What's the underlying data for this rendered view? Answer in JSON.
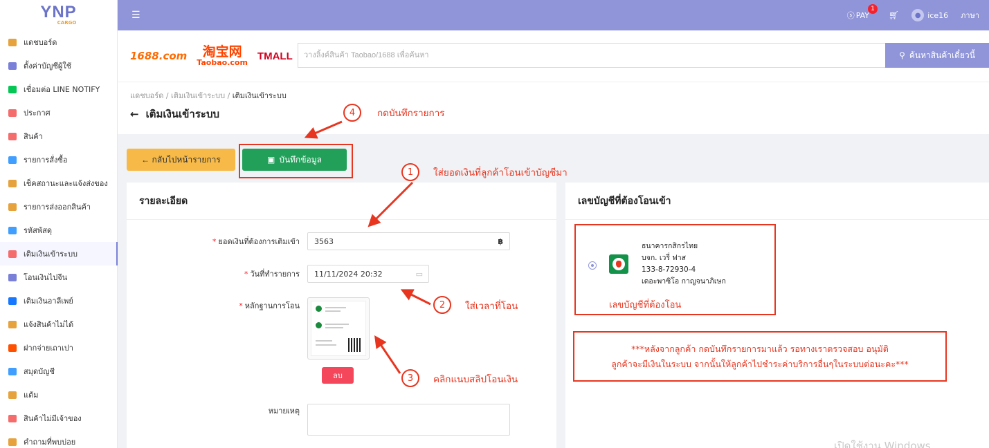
{
  "logo": {
    "main": "YNP",
    "sub": "CARGO"
  },
  "sidebar": {
    "items": [
      {
        "label": "แดชบอร์ด",
        "icon": "chart-icon",
        "color": "#e6a23c"
      },
      {
        "label": "ตั้งค่าบัญชีผู้ใช้",
        "icon": "user-settings-icon",
        "color": "#7a80d8"
      },
      {
        "label": "เชื่อมต่อ LINE NOTIFY",
        "icon": "line-icon",
        "color": "#06c755"
      },
      {
        "label": "ประกาศ",
        "icon": "announcement-icon",
        "color": "#f56c6c"
      },
      {
        "label": "สินค้า",
        "icon": "product-icon",
        "color": "#f56c6c"
      },
      {
        "label": "รายการสั่งซื้อ",
        "icon": "order-icon",
        "color": "#409eff"
      },
      {
        "label": "เช็คสถานะและแจ้งส่งของ",
        "icon": "truck-icon",
        "color": "#e6a23c"
      },
      {
        "label": "รายการส่งออกสินค้า",
        "icon": "export-icon",
        "color": "#e6a23c"
      },
      {
        "label": "รหัสพัสดุ",
        "icon": "parcel-icon",
        "color": "#409eff"
      },
      {
        "label": "เติมเงินเข้าระบบ",
        "icon": "wallet-icon",
        "color": "#f56c6c"
      },
      {
        "label": "โอนเงินไปจีน",
        "icon": "yuan-icon",
        "color": "#7a80d8"
      },
      {
        "label": "เติมเงินอาลีเพย์",
        "icon": "alipay-icon",
        "color": "#1677ff"
      },
      {
        "label": "แจ้งสินค้าไม่ได้",
        "icon": "report-icon",
        "color": "#e6a23c"
      },
      {
        "label": "ฝากจ่ายเถาเปา",
        "icon": "taobao-pay-icon",
        "color": "#ff5000"
      },
      {
        "label": "สมุดบัญชี",
        "icon": "ledger-icon",
        "color": "#409eff"
      },
      {
        "label": "แต้ม",
        "icon": "points-icon",
        "color": "#e6a23c"
      },
      {
        "label": "สินค้าไม่มีเจ้าของ",
        "icon": "unclaimed-icon",
        "color": "#f56c6c"
      },
      {
        "label": "คำถามที่พบบ่อย",
        "icon": "faq-icon",
        "color": "#e6a23c"
      }
    ]
  },
  "header": {
    "pay_label": "PAY",
    "pay_badge": "1",
    "username": "ice16",
    "language_label": "ภาษา"
  },
  "search": {
    "brand_1688": "1688.com",
    "brand_taobao_cn": "淘宝网",
    "brand_taobao_en": "Taobao.com",
    "brand_tmall": "TMALL",
    "placeholder": "วางลิ้งค์สินค้า Taobao/1688 เพื่อค้นหา",
    "button_label": "ค้นหาสินค้าเดี๋ยวนี้"
  },
  "breadcrumb": {
    "home": "แดชบอร์ด",
    "parent": "เติมเงินเข้าระบบ",
    "current": "เติมเงินเข้าระบบ"
  },
  "page_title": "เติมเงินเข้าระบบ",
  "actions": {
    "back_label": "← กลับไปหน้ารายการ",
    "save_label": "บันทึกข้อมูล"
  },
  "form": {
    "card_title": "รายละเอียด",
    "amount_label": "ยอดเงินที่ต้องการเติมเข้า",
    "amount_value": "3563",
    "currency": "฿",
    "date_label": "วันที่ทำรายการ",
    "date_value": "11/11/2024 20:32",
    "proof_label": "หลักฐานการโอน",
    "delete_label": "ลบ",
    "note_label": "หมายเหตุ"
  },
  "bank": {
    "card_title": "เลขบัญชีที่ต้องโอนเข้า",
    "bank_name": "ธนาคารกสิกรไทย",
    "company": "บจก. เวรี่ ฟาส",
    "account_number": "133-8-72930-4",
    "account_holder": "เดอะพาซิโอ กาญจนาภิเษก"
  },
  "annotations": {
    "step1_num": "1",
    "step1_text": "ใส่ยอดเงินที่ลูกค้าโอนเข้าบัญชีมา",
    "step2_num": "2",
    "step2_text": "ใส่เวลาที่โอน",
    "step3_num": "3",
    "step3_text": "คลิกแนบสลิปโอนเงิน",
    "step4_num": "4",
    "step4_text": "กดบันทึกรายการ",
    "bank_note": "เลขบัญชีที่ต้องโอน",
    "warning_line1": "***หลังจากลูกค้า กดบันทึกรายการมาแล้ว รอทางเราตรวจสอบ อนุมัติ",
    "warning_line2": "ลูกค้าจะมีเงินในระบบ จากนั้นให้ลูกค้าไปชำระค่าบริการอื่นๆในระบบต่อนะคะ***"
  },
  "watermark": "เปิดใช้งาน Windows",
  "colors": {
    "primary": "#8f95d8",
    "save": "#22a05a",
    "back": "#f7ba48",
    "annotation": "#e8351f",
    "delete": "#f5475c"
  }
}
